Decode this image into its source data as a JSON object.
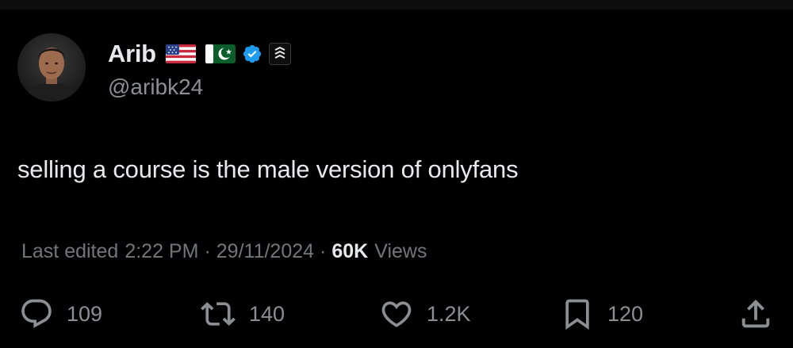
{
  "user": {
    "display_name": "Arib",
    "handle": "@aribk24"
  },
  "tweet": {
    "text": "selling a course is the male version of onlyfans"
  },
  "meta": {
    "prefix": "Last edited",
    "time": "2:22 PM",
    "date": "29/11/2024",
    "views_count": "60K",
    "views_label": "Views"
  },
  "actions": {
    "replies": "109",
    "retweets": "140",
    "likes": "1.2K",
    "bookmarks": "120"
  },
  "icons": {
    "reply": "reply-icon",
    "retweet": "retweet-icon",
    "like": "heart-icon",
    "bookmark": "bookmark-icon",
    "share": "share-icon",
    "verified": "verified-badge-icon",
    "flags": [
      "us-flag-icon",
      "pakistan-flag-icon"
    ]
  },
  "colors": {
    "background": "#000000",
    "text_primary": "#e7e9ea",
    "text_secondary": "#71767b",
    "verified_blue": "#1d9bf0"
  }
}
